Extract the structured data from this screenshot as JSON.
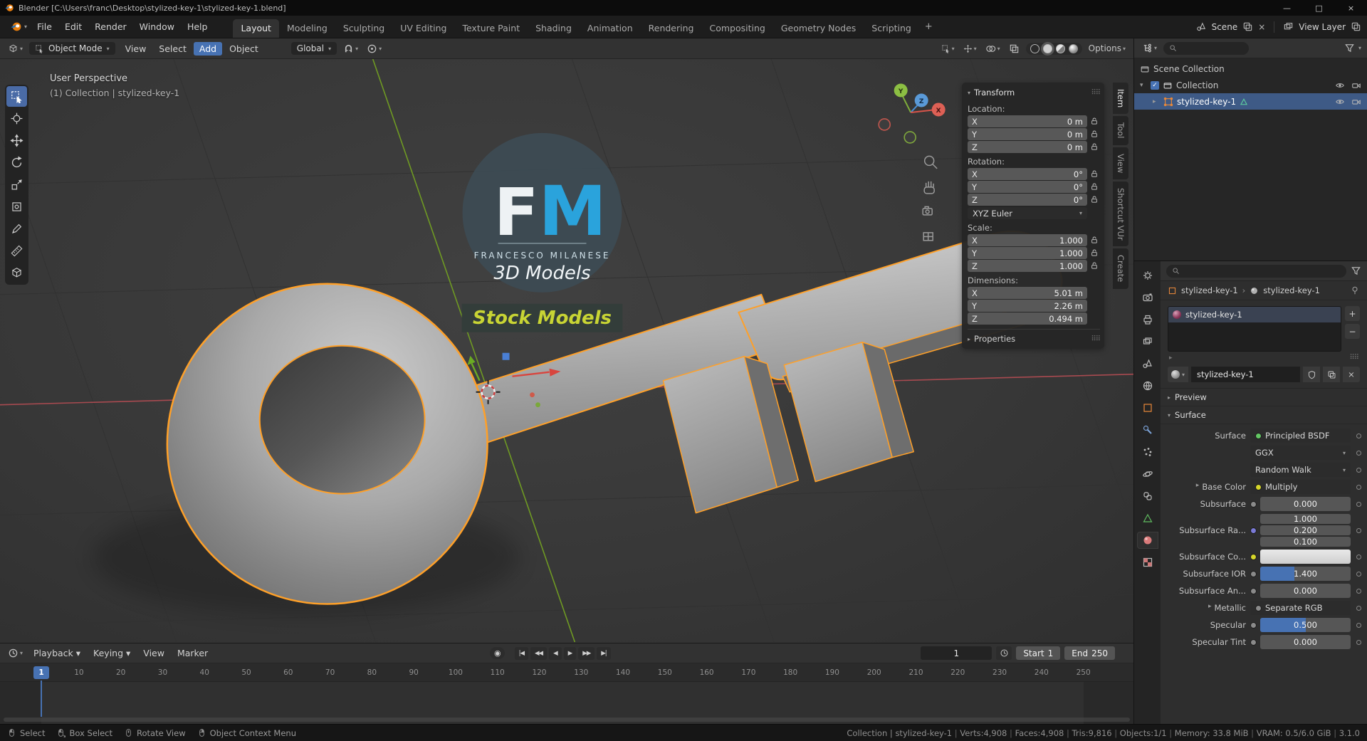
{
  "colors": {
    "accent": "#4772b3",
    "selection_outline": "#ffa028"
  },
  "window": {
    "title": "Blender [C:\\Users\\franc\\Desktop\\stylized-key-1\\stylized-key-1.blend]",
    "controls": [
      {
        "name": "minimize",
        "glyph": "—"
      },
      {
        "name": "maximize",
        "glyph": "□"
      },
      {
        "name": "close",
        "glyph": "×"
      }
    ]
  },
  "topbar": {
    "menus": [
      "File",
      "Edit",
      "Render",
      "Window",
      "Help"
    ],
    "workspaces": [
      "Layout",
      "Modeling",
      "Sculpting",
      "UV Editing",
      "Texture Paint",
      "Shading",
      "Animation",
      "Rendering",
      "Compositing",
      "Geometry Nodes",
      "Scripting"
    ],
    "active_workspace": "Layout",
    "add_tab": "+",
    "scene_label": "Scene",
    "view_layer_label": "View Layer"
  },
  "viewport_header": {
    "mode": "Object Mode",
    "menus": [
      "View",
      "Select",
      "Add",
      "Object"
    ],
    "active_menu": "Add",
    "orientation": "Global",
    "options": "Options"
  },
  "tools": [
    "select-box",
    "cursor",
    "move",
    "rotate",
    "scale",
    "transform",
    "annotate",
    "measure",
    "add-cube"
  ],
  "viewport": {
    "perspective": "User Perspective",
    "context": "(1) Collection | stylized-key-1",
    "axis": {
      "x": "X",
      "y": "Y",
      "z": "Z"
    },
    "watermark": {
      "f": "F",
      "m": "M",
      "name": "FRANCESCO MILANESE",
      "subtitle": "3D Models",
      "badge": "Stock Models"
    }
  },
  "n_panel": {
    "tabs": [
      "Item",
      "Tool",
      "View",
      "Shortcut VUr",
      "Create"
    ],
    "active_tab": "Item",
    "transform_title": "Transform",
    "sections": [
      {
        "id": "location",
        "label": "Location:",
        "locks": true,
        "rows": [
          {
            "axis": "X",
            "value": "0 m"
          },
          {
            "axis": "Y",
            "value": "0 m"
          },
          {
            "axis": "Z",
            "value": "0 m"
          }
        ]
      },
      {
        "id": "rotation",
        "label": "Rotation:",
        "locks": true,
        "dropdown": "XYZ Euler",
        "rows": [
          {
            "axis": "X",
            "value": "0°"
          },
          {
            "axis": "Y",
            "value": "0°"
          },
          {
            "axis": "Z",
            "value": "0°"
          }
        ]
      },
      {
        "id": "scale",
        "label": "Scale:",
        "locks": true,
        "rows": [
          {
            "axis": "X",
            "value": "1.000"
          },
          {
            "axis": "Y",
            "value": "1.000"
          },
          {
            "axis": "Z",
            "value": "1.000"
          }
        ]
      },
      {
        "id": "dimensions",
        "label": "Dimensions:",
        "locks": false,
        "rows": [
          {
            "axis": "X",
            "value": "5.01 m"
          },
          {
            "axis": "Y",
            "value": "2.26 m"
          },
          {
            "axis": "Z",
            "value": "0.494 m"
          }
        ]
      }
    ],
    "properties_panel": "Properties"
  },
  "outliner": {
    "scene_collection": "Scene Collection",
    "collection": "Collection",
    "object": "stylized-key-1"
  },
  "properties": {
    "breadcrumb_object": "stylized-key-1",
    "breadcrumb_material": "stylized-key-1",
    "slot_name": "stylized-key-1",
    "material_name": "stylized-key-1",
    "preview_label": "Preview",
    "surface_label": "Surface",
    "surface_rows": [
      {
        "id": "surface",
        "label": "Surface",
        "widget": "node",
        "value": "Principled BSDF",
        "socket": "#63c763"
      },
      {
        "id": "distribution",
        "label": "",
        "widget": "dropdown",
        "value": "GGX"
      },
      {
        "id": "subsurface-method",
        "label": "",
        "widget": "dropdown",
        "value": "Random Walk"
      },
      {
        "id": "base-color",
        "label": "Base Color",
        "expand": true,
        "widget": "node",
        "value": "Multiply",
        "socket": "#d6d62a"
      },
      {
        "id": "subsurface",
        "label": "Subsurface",
        "widget": "value",
        "value": "0.000",
        "socket": "#8a8a8a"
      },
      {
        "id": "subsurface-radius",
        "label": "Subsurface Ra...",
        "widget": "vector",
        "values": [
          "1.000",
          "0.200",
          "0.100"
        ],
        "socket": "#7a7ad6"
      },
      {
        "id": "subsurface-color",
        "label": "Subsurface Co...",
        "widget": "color",
        "socket": "#d6d62a"
      },
      {
        "id": "subsurface-ior",
        "label": "Subsurface IOR",
        "widget": "slider",
        "value": "1.400",
        "fill": 0.38,
        "socket": "#8a8a8a"
      },
      {
        "id": "subsurface-anisotropy",
        "label": "Subsurface An...",
        "widget": "slider",
        "value": "0.000",
        "fill": 0,
        "socket": "#8a8a8a"
      },
      {
        "id": "metallic",
        "label": "Metallic",
        "expand": true,
        "widget": "node",
        "value": "Separate RGB",
        "socket": "#8a8a8a"
      },
      {
        "id": "specular",
        "label": "Specular",
        "widget": "slider",
        "value": "0.500",
        "fill": 0.5,
        "socket": "#8a8a8a"
      },
      {
        "id": "specular-tint",
        "label": "Specular Tint",
        "widget": "slider",
        "value": "0.000",
        "fill": 0,
        "socket": "#8a8a8a"
      }
    ]
  },
  "timeline": {
    "menus": [
      "Playback",
      "Keying",
      "View",
      "Marker"
    ],
    "menu_carets": [
      true,
      true,
      false,
      false
    ],
    "record_glyph": "◉",
    "transport": [
      {
        "name": "jump-to-start",
        "glyph": "|◀"
      },
      {
        "name": "previous-keyframe",
        "glyph": "◀◀"
      },
      {
        "name": "play-reverse",
        "glyph": "◀"
      },
      {
        "name": "play",
        "glyph": "▶"
      },
      {
        "name": "next-keyframe",
        "glyph": "▶▶"
      },
      {
        "name": "jump-to-end",
        "glyph": "▶|"
      }
    ],
    "current_frame": "1",
    "start_label": "Start",
    "start_value": "1",
    "end_label": "End",
    "end_value": "250",
    "ticks": [
      10,
      20,
      30,
      40,
      50,
      60,
      70,
      80,
      90,
      100,
      110,
      120,
      130,
      140,
      150,
      160,
      170,
      180,
      190,
      200,
      210,
      220,
      230,
      240,
      250
    ]
  },
  "status_bar": {
    "hints": [
      {
        "icon": "mouse-left",
        "label": "Select"
      },
      {
        "icon": "mouse-left-drag",
        "label": "Box Select"
      },
      {
        "icon": "mouse-middle",
        "label": "Rotate View"
      },
      {
        "icon": "mouse-right",
        "label": "Object Context Menu"
      }
    ],
    "stats": [
      "Collection | stylized-key-1",
      "Verts:4,908",
      "Faces:4,908",
      "Tris:9,816",
      "Objects:1/1",
      "Memory: 33.8 MiB",
      "VRAM: 0.5/6.0 GiB",
      "3.1.0"
    ]
  }
}
